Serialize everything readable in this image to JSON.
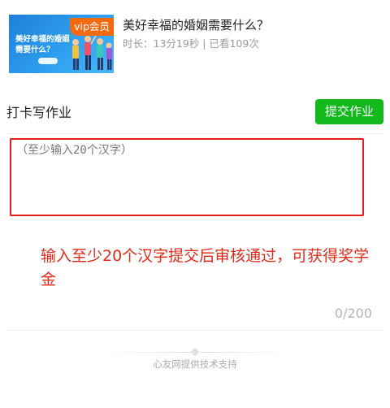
{
  "lesson": {
    "thumbnail_text": "美好幸福的婚姻需要什么？",
    "vip_badge": "vip会员",
    "title": "美好幸福的婚姻需要什么？",
    "meta": "时长：13分19秒 | 已看109次"
  },
  "homework": {
    "section_title": "打卡写作业",
    "submit_label": "提交作业",
    "input_value": "",
    "input_placeholder": "（至少输入20个汉字）",
    "note": "输入至少20个汉字提交后审核通过，可获得奖学金",
    "char_counter": "0/200"
  },
  "footer": {
    "text": "心友网提供技术支持"
  },
  "colors": {
    "accent_green": "#12b81c",
    "vip_orange": "#f36a10",
    "alert_red": "#e22a1a"
  }
}
